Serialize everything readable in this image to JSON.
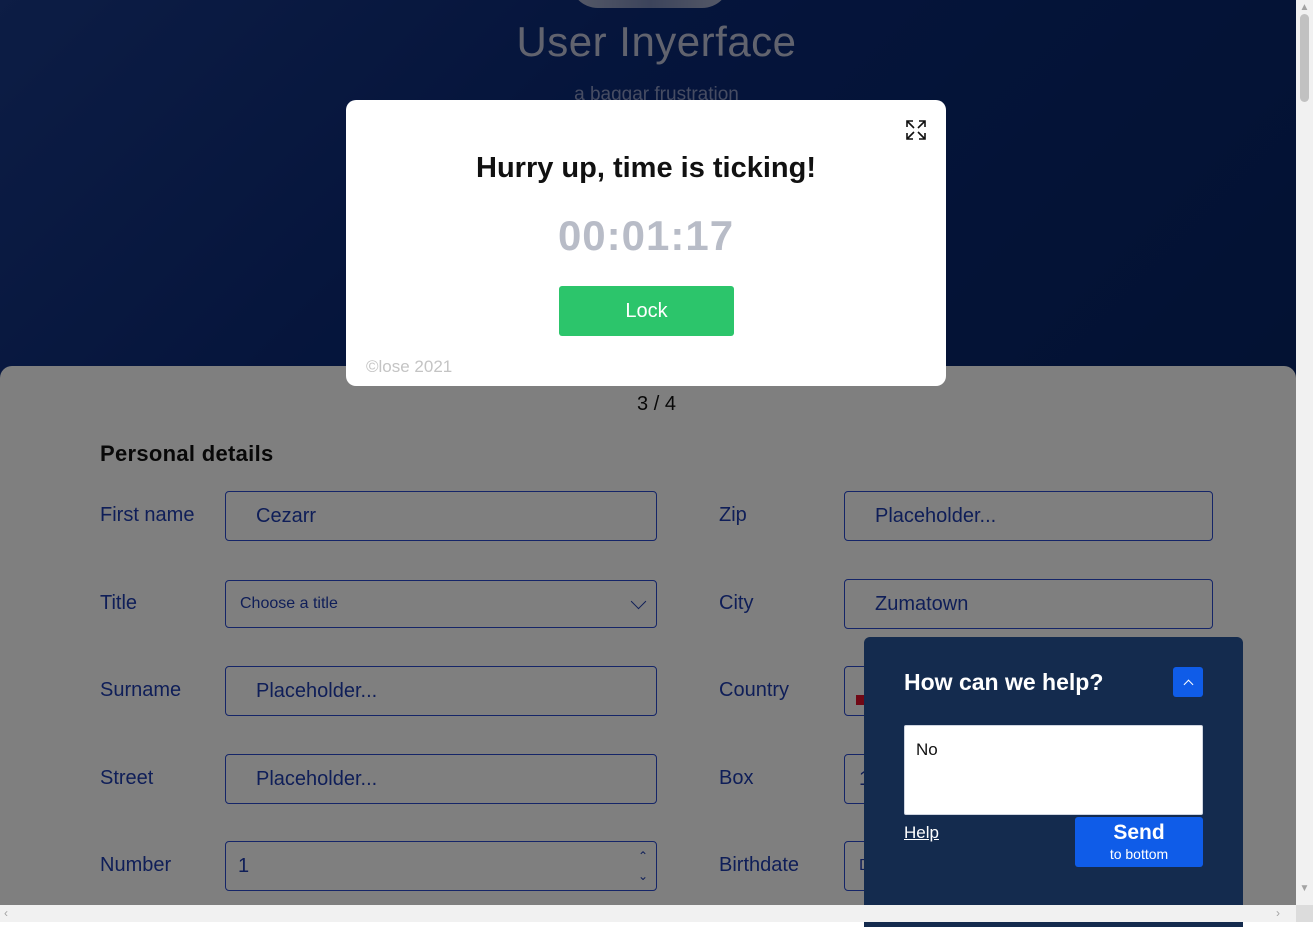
{
  "hero": {
    "title": "User Inyerface",
    "subtitle": "a baggar frustration"
  },
  "pager": "3 / 4",
  "form": {
    "section_title": "Personal details",
    "first_name": {
      "label": "First name",
      "value": "Cezarr"
    },
    "title": {
      "label": "Title",
      "value": "Choose a title"
    },
    "surname": {
      "label": "Surname",
      "placeholder": "Placeholder..."
    },
    "street": {
      "label": "Street",
      "placeholder": "Placeholder..."
    },
    "number": {
      "label": "Number",
      "value": "1"
    },
    "zip": {
      "label": "Zip",
      "placeholder": "Placeholder..."
    },
    "city": {
      "label": "City",
      "value": "Zumatown"
    },
    "country": {
      "label": "Country"
    },
    "box": {
      "label": "Box",
      "value": "1"
    },
    "birthdate": {
      "label": "Birthdate",
      "value": "D"
    }
  },
  "modal": {
    "heading": "Hurry up, time is ticking!",
    "timer": "00:01:17",
    "lock_label": "Lock",
    "close_text": "©lose 2021"
  },
  "chat": {
    "heading": "How can we help?",
    "message": "No",
    "help_label": "Help",
    "send_label": "Send",
    "send_sub": "to bottom"
  },
  "colors": {
    "hero_blue": "#0b2a78",
    "lock_green": "#2cc56b",
    "chat_bg": "#142b4e",
    "accent_blue": "#0f5ce8",
    "form_text": "#1e3db0"
  }
}
